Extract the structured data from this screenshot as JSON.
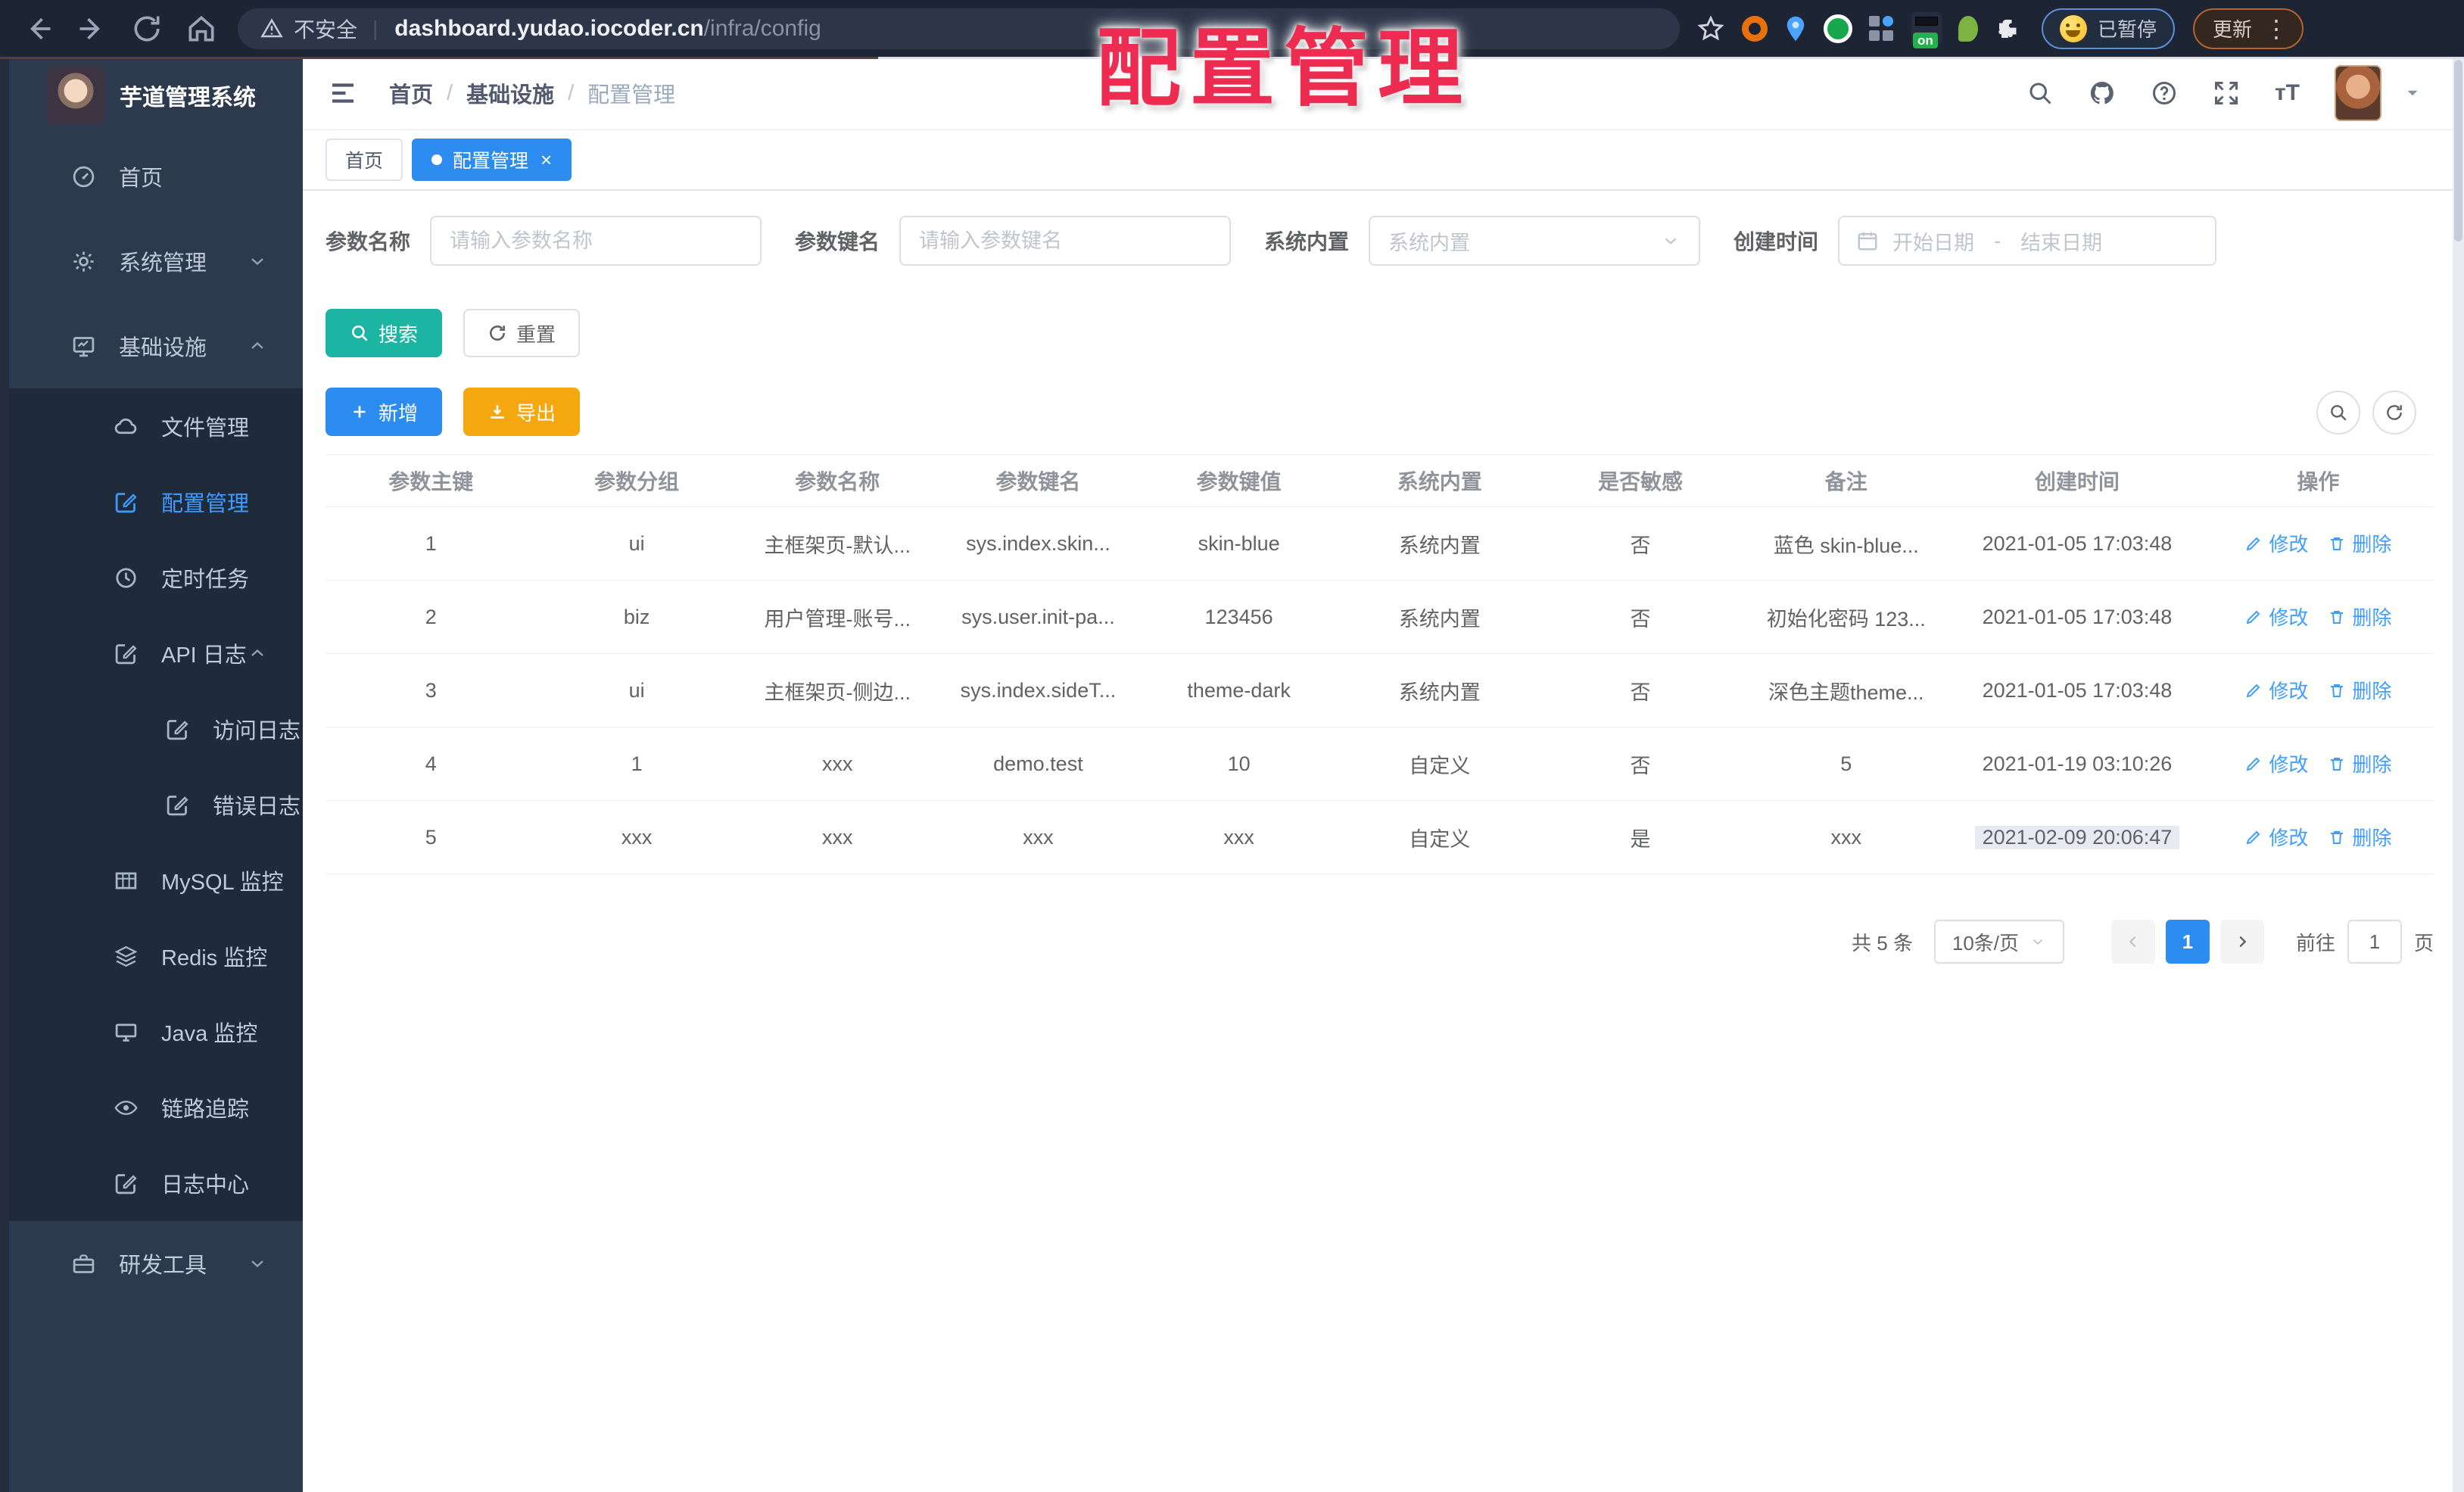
{
  "browser": {
    "security": "不安全",
    "host": "dashboard.yudao.iocoder.cn",
    "path": "/infra/config",
    "separator": "|",
    "on_badge": "on",
    "paused": "已暂停",
    "update": "更新"
  },
  "overlay_title": "配置管理",
  "app": {
    "title": "芋道管理系统"
  },
  "sidebar": {
    "items": [
      {
        "id": "home",
        "label": "首页",
        "icon": "dashboard-icon",
        "level": 1
      },
      {
        "id": "system",
        "label": "系统管理",
        "icon": "gear-icon",
        "level": 1,
        "chevron": "down"
      },
      {
        "id": "infra",
        "label": "基础设施",
        "icon": "monitor-icon",
        "level": 1,
        "chevron": "up"
      },
      {
        "id": "file",
        "label": "文件管理",
        "icon": "cloud-icon",
        "level": 2
      },
      {
        "id": "config",
        "label": "配置管理",
        "icon": "edit-icon",
        "level": 2,
        "active": true
      },
      {
        "id": "job",
        "label": "定时任务",
        "icon": "clock-icon",
        "level": 2
      },
      {
        "id": "api-log",
        "label": "API 日志",
        "icon": "log-icon",
        "level": 2,
        "chevron": "up"
      },
      {
        "id": "access-log",
        "label": "访问日志",
        "icon": "log-icon",
        "level": 3
      },
      {
        "id": "error-log",
        "label": "错误日志",
        "icon": "log-icon",
        "level": 3
      },
      {
        "id": "mysql",
        "label": "MySQL 监控",
        "icon": "table-icon",
        "level": 2
      },
      {
        "id": "redis",
        "label": "Redis 监控",
        "icon": "layers-icon",
        "level": 2
      },
      {
        "id": "java",
        "label": "Java 监控",
        "icon": "desktop-icon",
        "level": 2
      },
      {
        "id": "trace",
        "label": "链路追踪",
        "icon": "eye-icon",
        "level": 2
      },
      {
        "id": "log-center",
        "label": "日志中心",
        "icon": "log-icon",
        "level": 2
      },
      {
        "id": "dev-tools",
        "label": "研发工具",
        "icon": "briefcase-icon",
        "level": 1,
        "chevron": "down"
      }
    ]
  },
  "breadcrumb": {
    "items": [
      "首页",
      "基础设施",
      "配置管理"
    ],
    "separator": "/"
  },
  "tabs": [
    {
      "label": "首页",
      "active": false
    },
    {
      "label": "配置管理",
      "active": true,
      "closable": true
    }
  ],
  "filters": {
    "name_label": "参数名称",
    "name_placeholder": "请输入参数名称",
    "key_label": "参数键名",
    "key_placeholder": "请输入参数键名",
    "type_label": "系统内置",
    "type_placeholder": "系统内置",
    "date_label": "创建时间",
    "date_start": "开始日期",
    "date_separator": "-",
    "date_end": "结束日期"
  },
  "actions": {
    "search": "搜索",
    "reset": "重置",
    "add": "新增",
    "export": "导出"
  },
  "table": {
    "headers": [
      "参数主键",
      "参数分组",
      "参数名称",
      "参数键名",
      "参数键值",
      "系统内置",
      "是否敏感",
      "备注",
      "创建时间",
      "操作"
    ],
    "edit_label": "修改",
    "delete_label": "删除",
    "rows": [
      {
        "id": "1",
        "group": "ui",
        "name": "主框架页-默认...",
        "key": "sys.index.skin...",
        "value": "skin-blue",
        "type": "系统内置",
        "sensitive": "否",
        "remark": "蓝色 skin-blue...",
        "created": "2021-01-05 17:03:48"
      },
      {
        "id": "2",
        "group": "biz",
        "name": "用户管理-账号...",
        "key": "sys.user.init-pa...",
        "value": "123456",
        "type": "系统内置",
        "sensitive": "否",
        "remark": "初始化密码 123...",
        "created": "2021-01-05 17:03:48"
      },
      {
        "id": "3",
        "group": "ui",
        "name": "主框架页-侧边...",
        "key": "sys.index.sideT...",
        "value": "theme-dark",
        "type": "系统内置",
        "sensitive": "否",
        "remark": "深色主题theme...",
        "created": "2021-01-05 17:03:48"
      },
      {
        "id": "4",
        "group": "1",
        "name": "xxx",
        "key": "demo.test",
        "value": "10",
        "type": "自定义",
        "sensitive": "否",
        "remark": "5",
        "created": "2021-01-19 03:10:26"
      },
      {
        "id": "5",
        "group": "xxx",
        "name": "xxx",
        "key": "xxx",
        "value": "xxx",
        "type": "自定义",
        "sensitive": "是",
        "remark": "xxx",
        "created": "2021-02-09 20:06:47",
        "created_highlight": true
      }
    ]
  },
  "pagination": {
    "total": "共 5 条",
    "page_size": "10条/页",
    "current_page": "1",
    "goto_label": "前往",
    "goto_value": "1",
    "page_unit": "页"
  },
  "colors": {
    "primary_blue": "#2d8cf0",
    "teal": "#1cb5a3",
    "orange": "#f5a70f",
    "link_blue": "#409eff",
    "overlay_red": "#ee2b50",
    "sidebar_bg": "#2d3a4e",
    "submenu_bg": "#1f2b3b",
    "chrome_bg": "#1d2534"
  }
}
